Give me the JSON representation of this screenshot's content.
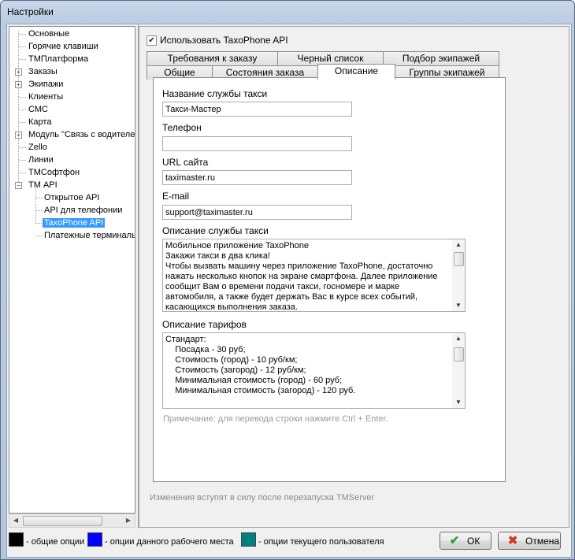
{
  "window": {
    "title": "Настройки"
  },
  "tree": {
    "items": [
      {
        "label": "Основные"
      },
      {
        "label": "Горячие клавиши"
      },
      {
        "label": "ТМПлатформа"
      },
      {
        "label": "Заказы"
      },
      {
        "label": "Экипажи"
      },
      {
        "label": "Клиенты"
      },
      {
        "label": "СМС"
      },
      {
        "label": "Карта"
      },
      {
        "label": "Модуль \"Связь с водителем\""
      },
      {
        "label": "Zello"
      },
      {
        "label": "Линии"
      },
      {
        "label": "ТМСофтфон"
      },
      {
        "label": "ТМ API"
      },
      {
        "label": "Открытое API"
      },
      {
        "label": "API для телефонии"
      },
      {
        "label": "TaxoPhone API"
      },
      {
        "label": "Платежные терминалы"
      }
    ]
  },
  "main": {
    "use_checkbox_label": "Использовать TaxoPhone API",
    "tabs_row1": [
      "Требования к заказу",
      "Черный список",
      "Подбор экипажей"
    ],
    "tabs_row2": [
      "Общие",
      "Состояния заказа",
      "Описание",
      "Группы экипажей"
    ],
    "active_tab": "Описание",
    "service_name_label": "Название службы такси",
    "service_name_value": "Такси-Мастер",
    "phone_label": "Телефон",
    "phone_value": "",
    "url_label": "URL сайта",
    "url_value": "taximaster.ru",
    "email_label": "E-mail",
    "email_value": "support@taximaster.ru",
    "description_label": "Описание службы такси",
    "description_text": "Мобильное приложение TaxoPhone\nЗакажи такси в два клика!\nЧтобы вызвать машину через приложение TaxoPhone, достаточно\nнажать несколько кнопок на экране смартфона. Далее приложение\nсообщит Вам о времени подачи такси, госномере и марке\nавтомобиля, а также будет держать Вас в курсе всех событий,\nкасающихся выполнения заказа.",
    "tariffs_label": "Описание тарифов",
    "tariffs_text": "Стандарт:\n    Посадка - 30 руб;\n    Стоимость (город) - 10 руб/км;\n    Стоимость (загород) - 12 руб/км;\n    Минимальная стоимость (город) - 60 руб;\n    Минимальная стоимость (загород) - 120 руб.",
    "hint": "Примечание: для перевода строки нажмите Ctrl + Enter.",
    "restart_note": "Изменения вступят в силу после перезапуска TMServer"
  },
  "footer": {
    "legend": [
      {
        "label": "- общие опции",
        "color": "#000000"
      },
      {
        "label": "- опции данного рабочего места",
        "color": "#0000ff"
      },
      {
        "label": "- опции текущего пользователя",
        "color": "#008080"
      }
    ],
    "ok_label": "ОК",
    "cancel_label": "Отмена"
  },
  "colors": {
    "selection": "#3399ff",
    "ok_icon": "#2e9e2e",
    "cancel_icon": "#d33a2a"
  }
}
